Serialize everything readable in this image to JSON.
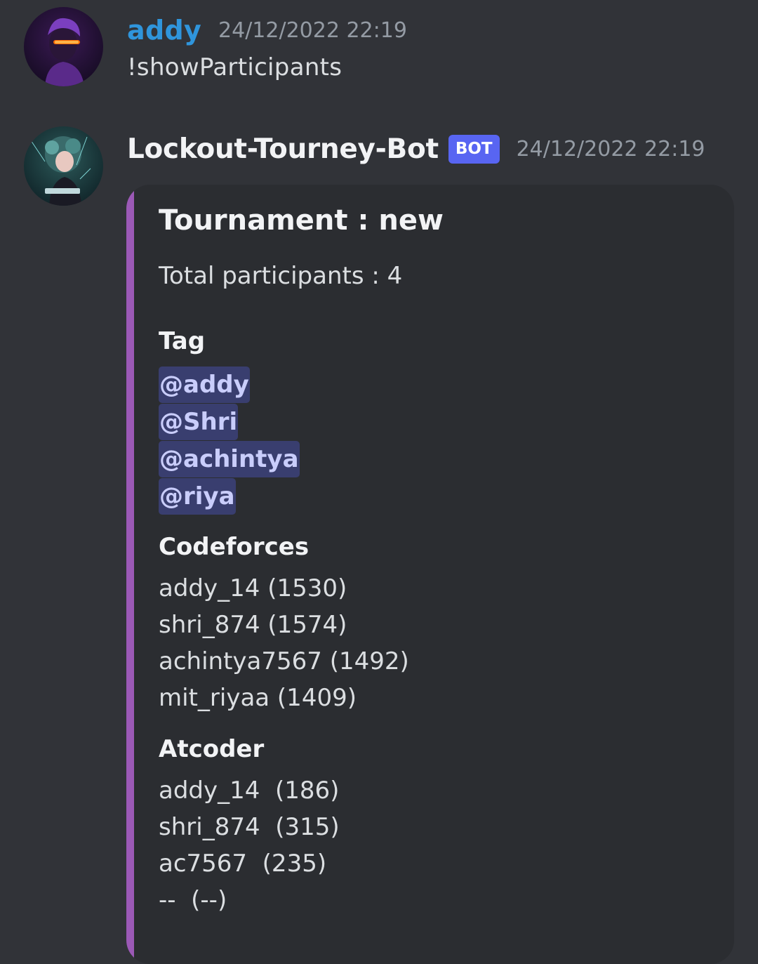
{
  "messages": [
    {
      "author": "addy",
      "timestamp": "24/12/2022 22:19",
      "content": "!showParticipants"
    },
    {
      "author": "Lockout-Tourney-Bot",
      "badge": "BOT",
      "timestamp": "24/12/2022 22:19",
      "embed": {
        "color": "#9b59b6",
        "title": "Tournament : new",
        "description": "Total participants : 4",
        "fields": [
          {
            "name": "Tag",
            "mentions": [
              "@addy",
              "@Shri",
              "@achintya",
              "@riya"
            ]
          },
          {
            "name": "Codeforces",
            "values": [
              "addy_14 (1530)",
              "shri_874 (1574)",
              "achintya7567 (1492)",
              "mit_riyaa (1409)"
            ]
          },
          {
            "name": "Atcoder",
            "values": [
              "addy_14  (186)",
              "shri_874  (315)",
              "ac7567  (235)",
              "--  (--)"
            ]
          }
        ]
      }
    }
  ],
  "colors": {
    "background": "#313338",
    "embed_background": "#2b2d31",
    "user_name": "#2f95dc",
    "bot_badge": "#5865f2",
    "mention_text": "#c9cdfb"
  },
  "icons": [
    "user-avatar-icon",
    "bot-avatar-icon"
  ]
}
